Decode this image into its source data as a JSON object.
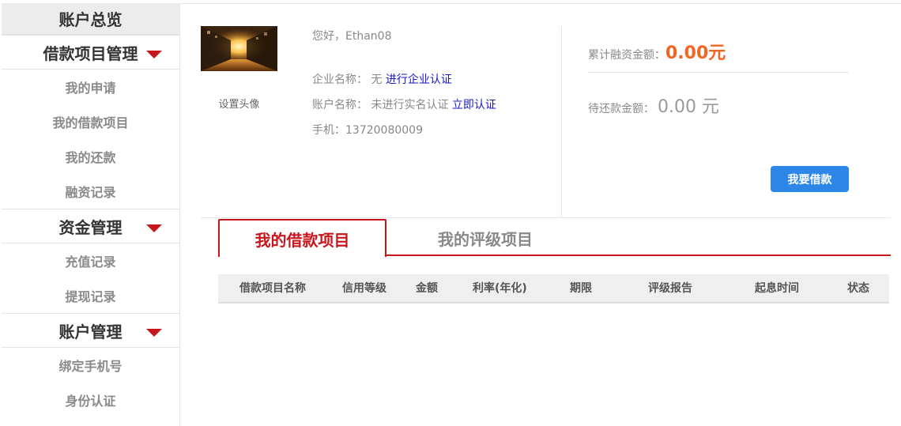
{
  "sidebar": {
    "title": "账户总览",
    "sections": [
      {
        "title": "借款项目管理",
        "items": [
          "我的申请",
          "我的借款项目",
          "我的还款",
          "融资记录"
        ]
      },
      {
        "title": "资金管理",
        "items": [
          "充值记录",
          "提现记录"
        ]
      },
      {
        "title": "账户管理",
        "items": [
          "绑定手机号",
          "身份认证"
        ]
      }
    ]
  },
  "profile": {
    "set_avatar": "设置头像",
    "greeting": "您好，Ethan08",
    "company_label": "企业名称：",
    "company_value": "无",
    "company_link": "进行企业认证",
    "account_label": "账户名称：",
    "account_value": "未进行实名认证",
    "account_link": "立即认证",
    "phone": "手机：13720080009"
  },
  "stats": {
    "total_label": "累计融资金额：",
    "total_value": "0.00元",
    "pending_label": "待还款金额：",
    "pending_value": "0.00 元",
    "loan_button": "我要借款"
  },
  "tabs": [
    "我的借款项目",
    "我的评级项目"
  ],
  "table": {
    "columns": [
      "借款项目名称",
      "信用等级",
      "金额",
      "利率(年化)",
      "期限",
      "评级报告",
      "起息时间",
      "状态"
    ]
  },
  "colors": {
    "accent_red": "#c8161d",
    "amount_orange": "#f26522",
    "button_blue": "#2d87e8"
  }
}
